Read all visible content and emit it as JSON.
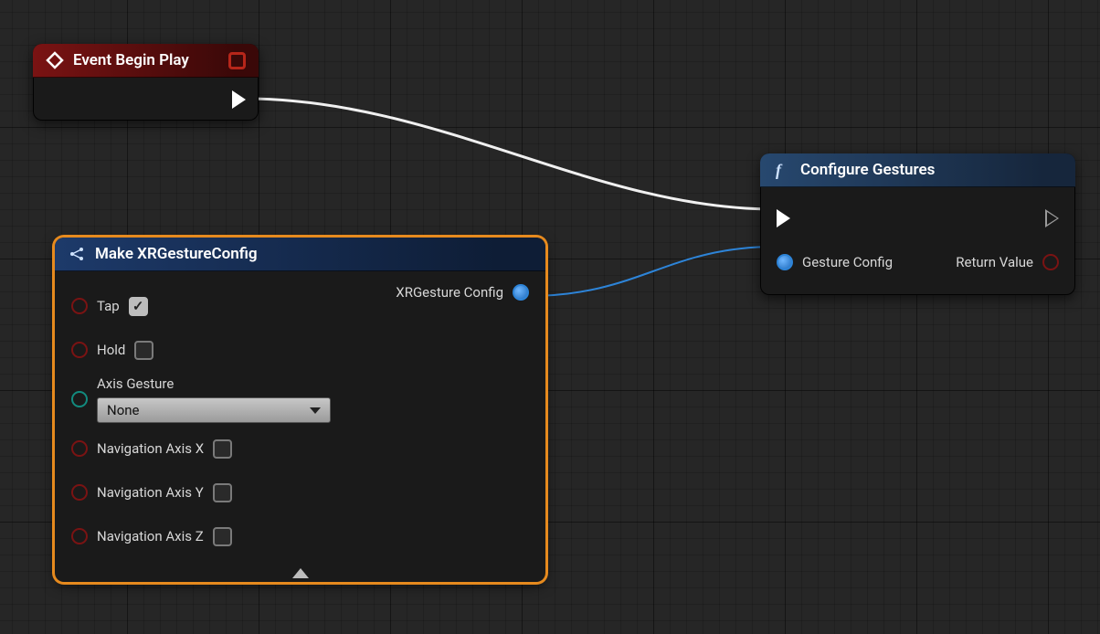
{
  "event_node": {
    "title": "Event Begin Play"
  },
  "config_node": {
    "title": "Configure Gestures",
    "input_pin_label": "Gesture Config",
    "output_pin_label": "Return Value"
  },
  "make_node": {
    "title": "Make XRGestureConfig",
    "output_pin_label": "XRGesture Config",
    "inputs": {
      "tap": {
        "label": "Tap",
        "checked": true
      },
      "hold": {
        "label": "Hold",
        "checked": false
      },
      "axis_gesture": {
        "label": "Axis Gesture",
        "value": "None"
      },
      "nav_x": {
        "label": "Navigation Axis X",
        "checked": false
      },
      "nav_y": {
        "label": "Navigation Axis Y",
        "checked": false
      },
      "nav_z": {
        "label": "Navigation Axis Z",
        "checked": false
      }
    }
  }
}
